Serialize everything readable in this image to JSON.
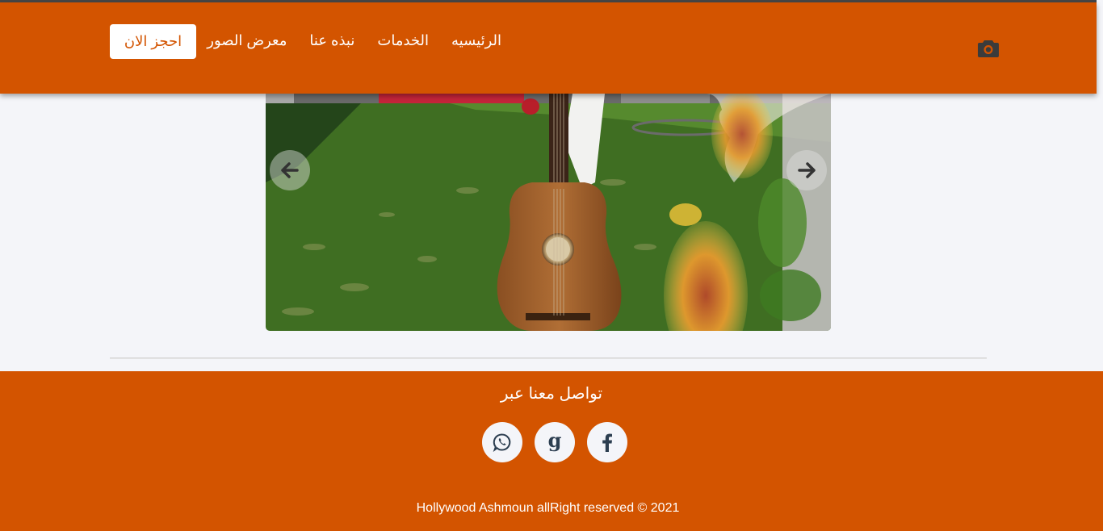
{
  "nav": {
    "brand_icon": "camera-icon",
    "links": [
      {
        "label": "الرئيسيه"
      },
      {
        "label": "الخدمات"
      },
      {
        "label": "نبذه عنا"
      },
      {
        "label": "معرض الصور"
      }
    ],
    "book_button": "احجز الان"
  },
  "carousel": {
    "prev_icon": "arrow-left-icon",
    "next_icon": "arrow-right-icon"
  },
  "footer": {
    "contact_title": "تواصل معنا عبر",
    "socials": [
      {
        "name": "whatsapp-icon"
      },
      {
        "name": "google-icon"
      },
      {
        "name": "facebook-icon"
      }
    ],
    "copyright": "Hollywood Ashmoun allRight reserved © 2021"
  },
  "colors": {
    "accent": "#d35400",
    "background": "#f4f5f9",
    "icon_dark": "#2c3e50"
  }
}
